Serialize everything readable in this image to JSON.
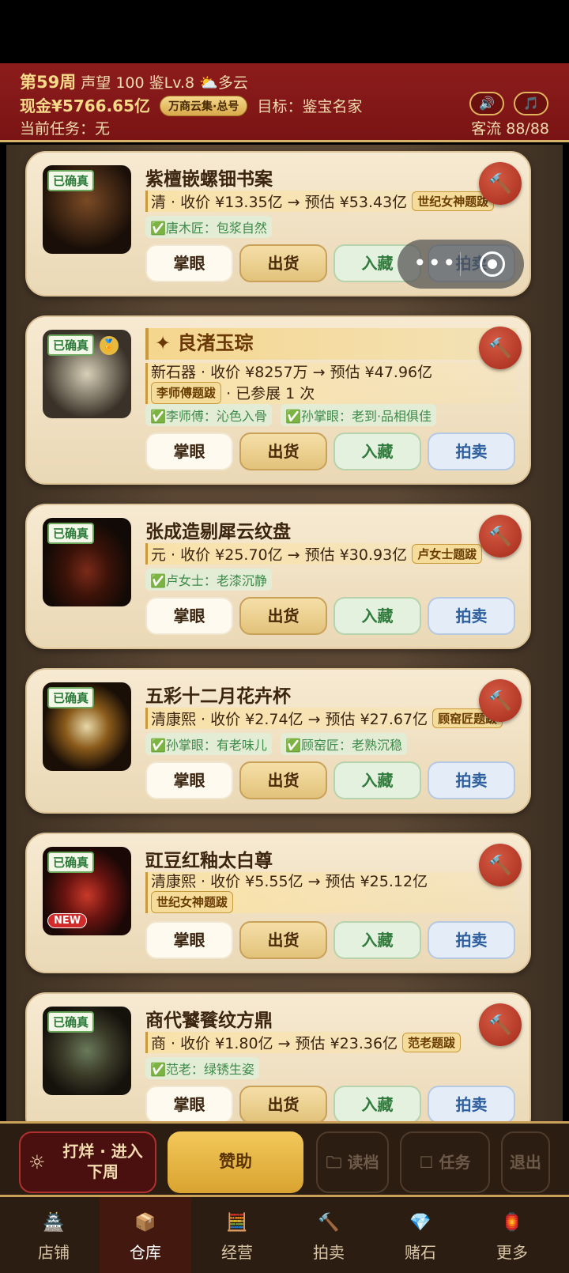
{
  "header": {
    "week": "第59周",
    "reputation": "声望 100",
    "level": "鉴Lv.8",
    "weather_icon": "⛅",
    "weather": "多云",
    "cash": "现金¥5766.65亿",
    "market_badge": "万商云集·总号",
    "goal": "目标：鉴宝名家",
    "task": "当前任务：无",
    "traffic": "客流 88/88",
    "sound_icon": "🔊",
    "music_icon": "🎵"
  },
  "capsule": {
    "dots": "•••"
  },
  "labels": {
    "authenticated": "已确真",
    "new_badge": "NEW",
    "btn_eye": "掌眼",
    "btn_ship": "出货",
    "btn_collect": "入藏",
    "btn_auction": "拍卖",
    "hammer": "🔨"
  },
  "items": [
    {
      "name": "紫檀嵌螺钿书案",
      "info": "清 · 收价 ¥13.35亿 → 预估 ¥53.43亿",
      "tag": "世纪女神题跋",
      "comments": [
        "✅唐木匠：包浆自然"
      ]
    },
    {
      "name": "良渚玉琮",
      "special_icon": "✦",
      "info": "新石器 · 收价 ¥8257万 → 预估 ¥47.96亿",
      "tag": "李师傅题跋",
      "extra": "· 已参展 1 次",
      "medal": "🏅",
      "comments": [
        "✅李师傅：沁色入骨",
        "✅孙掌眼：老到·品相俱佳"
      ]
    },
    {
      "name": "张成造剔犀云纹盘",
      "info": "元 · 收价 ¥25.70亿 → 预估 ¥30.93亿",
      "tag": "卢女士题跋",
      "comments": [
        "✅卢女士：老漆沉静"
      ]
    },
    {
      "name": "五彩十二月花卉杯",
      "info": "清康熙 · 收价 ¥2.74亿 → 预估 ¥27.67亿",
      "tag": "顾窑匠题跋",
      "comments": [
        "✅孙掌眼：有老味儿",
        "✅顾窑匠：老熟沉稳"
      ]
    },
    {
      "name": "豇豆红釉太白尊",
      "info": "清康熙 · 收价 ¥5.55亿 → 预估 ¥25.12亿",
      "tag": "世纪女神题跋",
      "comments": []
    },
    {
      "name": "商代饕餮纹方鼎",
      "info": "商 · 收价 ¥1.80亿 → 预估 ¥23.36亿",
      "tag": "范老题跋",
      "comments": [
        "✅范老：绿锈生姿"
      ]
    }
  ],
  "actions": {
    "next_week_icon": "☼",
    "next_week": "打烊 · 进入下周",
    "sponsor": "赞助",
    "load": "🗀 读档",
    "task": "☐ 任务",
    "exit": "退出"
  },
  "tabs": [
    {
      "label": "店铺",
      "icon": "🏯"
    },
    {
      "label": "仓库",
      "icon": "📦"
    },
    {
      "label": "经营",
      "icon": "🧮"
    },
    {
      "label": "拍卖",
      "icon": "🔨"
    },
    {
      "label": "赌石",
      "icon": "💎"
    },
    {
      "label": "更多",
      "icon": "🏮"
    }
  ]
}
